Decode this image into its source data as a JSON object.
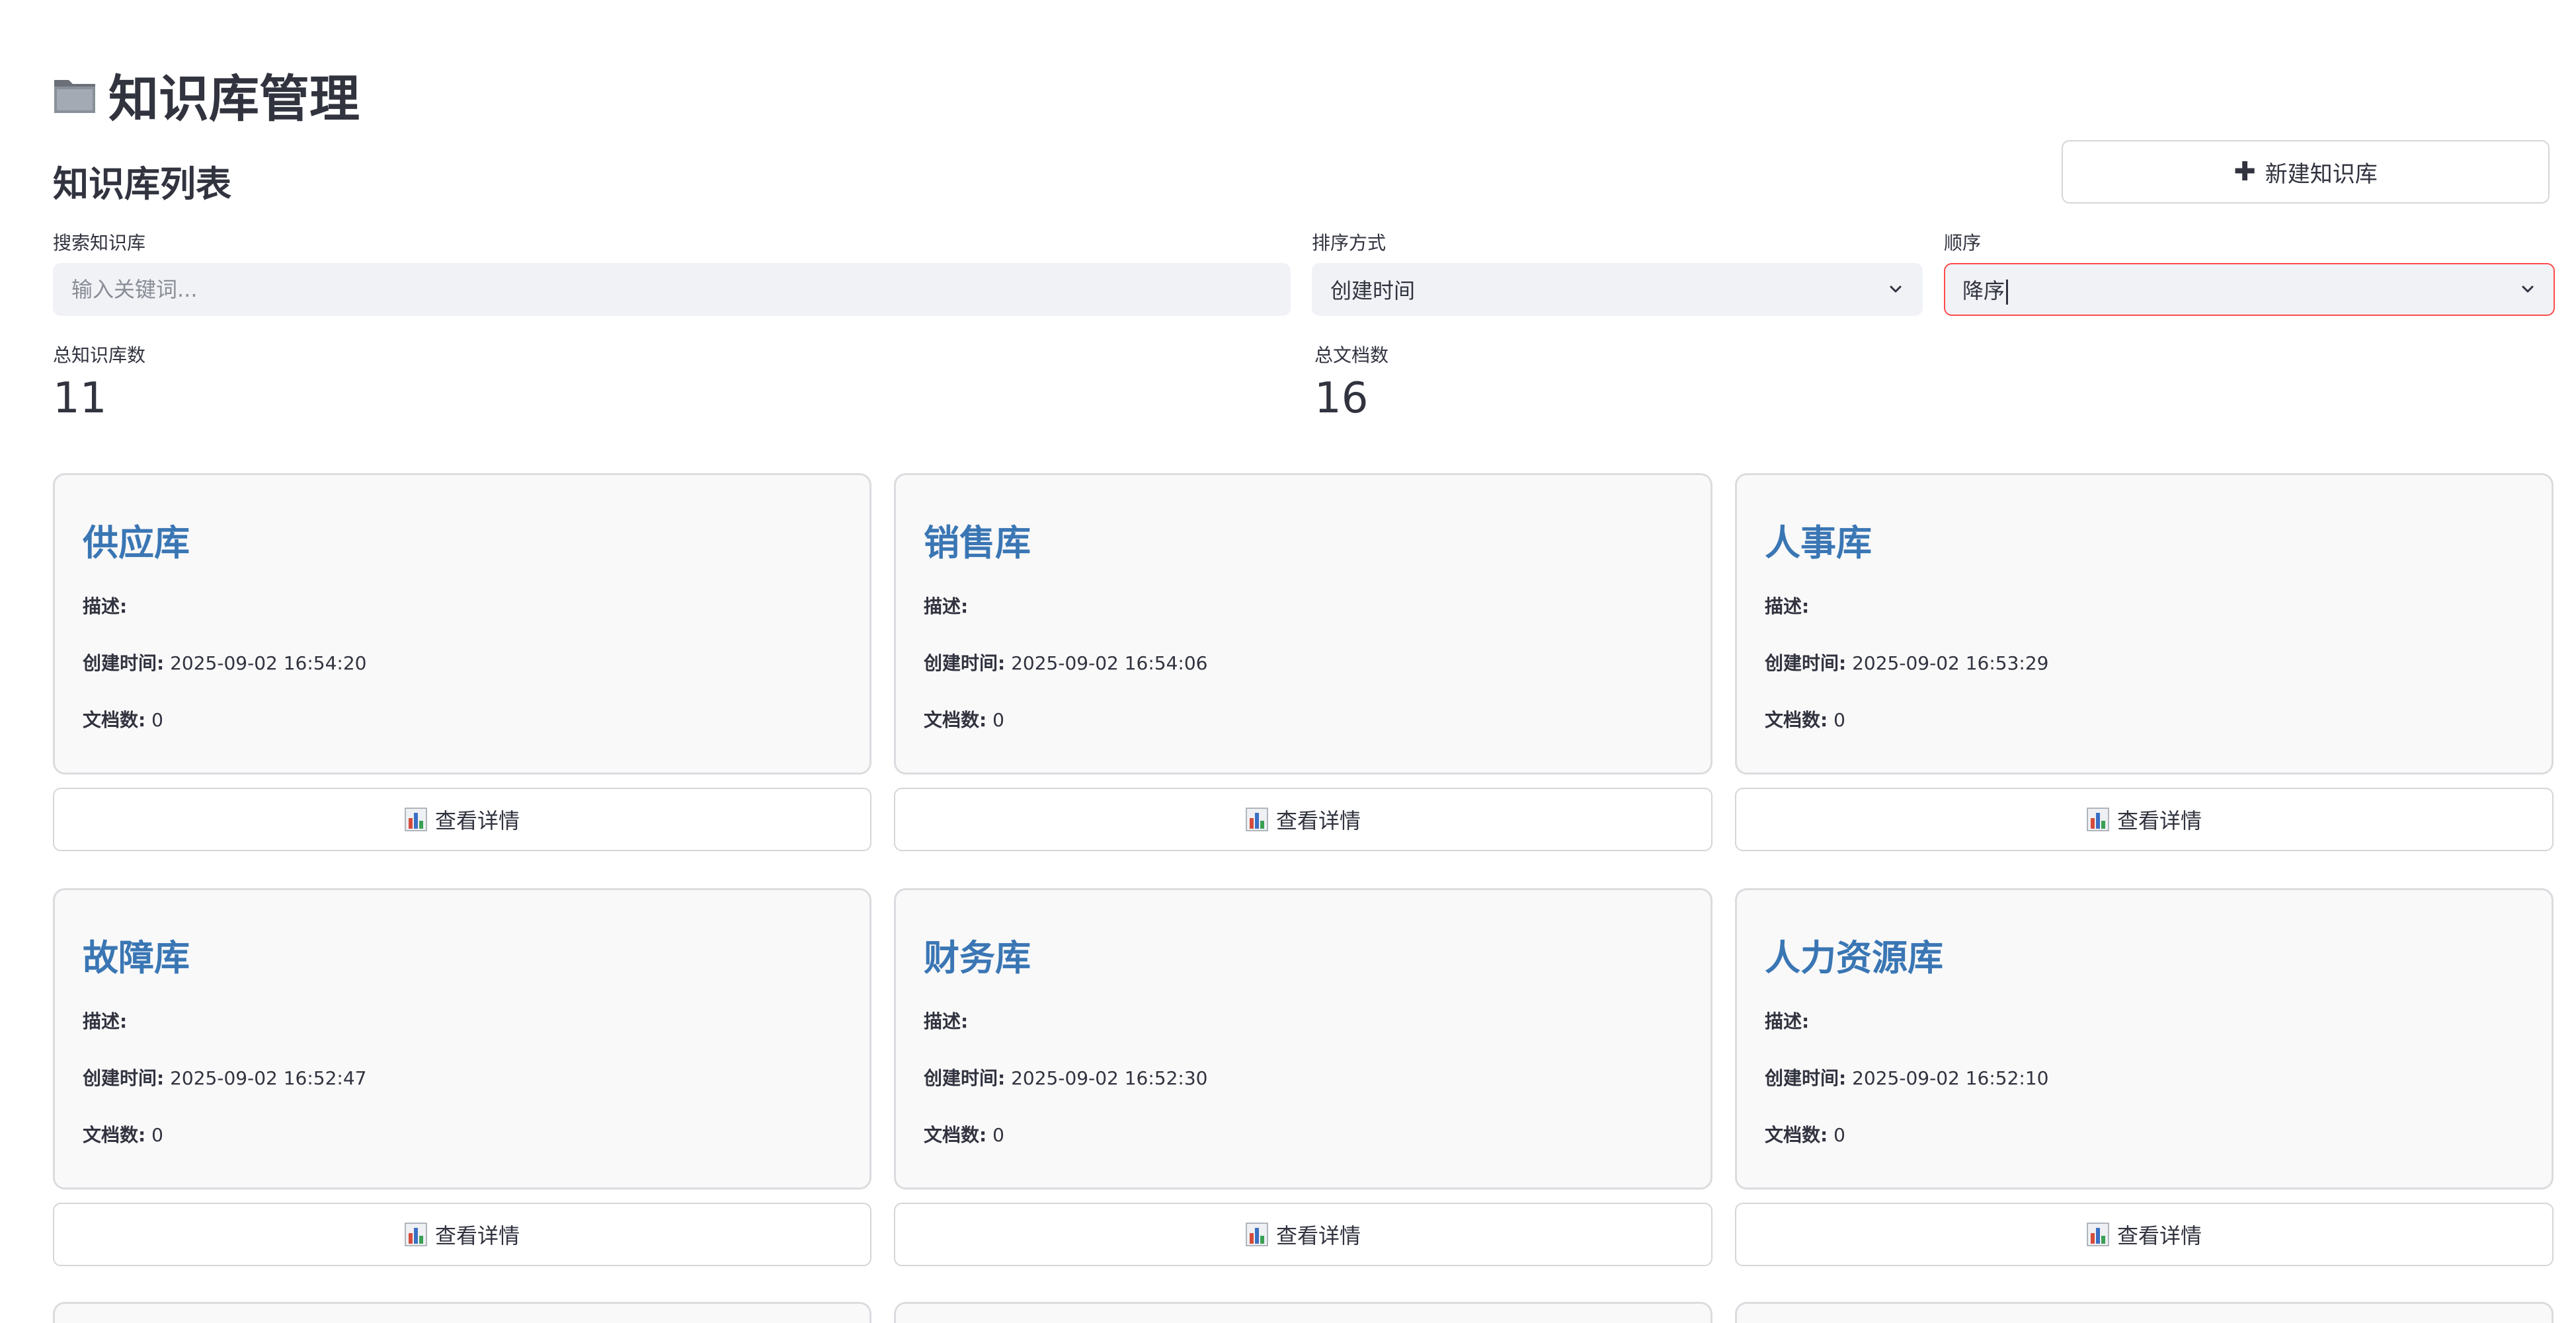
{
  "page": {
    "title": "知识库管理",
    "section_title": "知识库列表",
    "new_button_label": "新建知识库"
  },
  "filters": {
    "search_label": "搜索知识库",
    "search_placeholder": "输入关键词...",
    "search_value": "",
    "sort_label": "排序方式",
    "sort_value": "创建时间",
    "order_label": "顺序",
    "order_value": "降序"
  },
  "metrics": {
    "total_kb_label": "总知识库数",
    "total_kb_value": "11",
    "total_docs_label": "总文档数",
    "total_docs_value": "16"
  },
  "card_labels": {
    "description": "描述:",
    "created": "创建时间:",
    "docs": "文档数:",
    "detail_button": "查看详情"
  },
  "cards": [
    {
      "name": "供应库",
      "description": "",
      "created": "2025-09-02 16:54:20",
      "docs": "0"
    },
    {
      "name": "销售库",
      "description": "",
      "created": "2025-09-02 16:54:06",
      "docs": "0"
    },
    {
      "name": "人事库",
      "description": "",
      "created": "2025-09-02 16:53:29",
      "docs": "0"
    },
    {
      "name": "故障库",
      "description": "",
      "created": "2025-09-02 16:52:47",
      "docs": "0"
    },
    {
      "name": "财务库",
      "description": "",
      "created": "2025-09-02 16:52:30",
      "docs": "0"
    },
    {
      "name": "人力资源库",
      "description": "",
      "created": "2025-09-02 16:52:10",
      "docs": "0"
    }
  ],
  "icons": {
    "title": "folder-icon",
    "new_button": "plus-icon",
    "detail_button": "bar-chart-icon",
    "select": "chevron-down-icon"
  },
  "colors": {
    "card_title": "#3a76b4",
    "focus_border": "#ff4b4b",
    "input_bg": "#f0f2f6",
    "card_bg": "#f9f9f9"
  }
}
